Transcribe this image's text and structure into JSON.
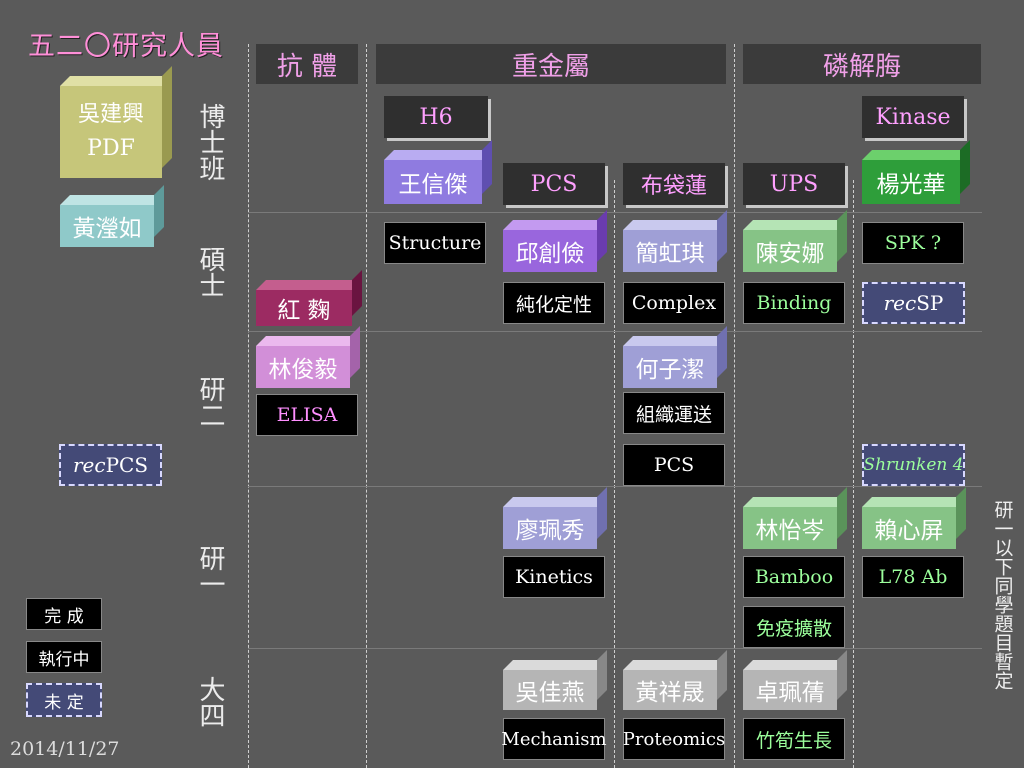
{
  "title": "五二〇研究人員",
  "headers": {
    "antibody": "抗 體",
    "heavy_metal": "重金屬",
    "phosphatase": "磷解脢"
  },
  "rows": {
    "phd": "博士班",
    "master": "碩士",
    "y2": "研二",
    "y1": "研一",
    "senior": "大四"
  },
  "left": {
    "advisor_line1": "吳建興",
    "advisor_line2": "PDF",
    "assistant": "黃瀅如",
    "rec_pcs_prefix": "rec",
    "rec_pcs_suffix": "PCS"
  },
  "phd": {
    "h6": "H6",
    "wang": "王信傑",
    "pcs": "PCS",
    "bu": "布袋蓮",
    "ups": "UPS",
    "kinase": "Kinase",
    "yang": "楊光華"
  },
  "master": {
    "structure": "Structure",
    "qiu": "邱創儉",
    "chun": "純化定性",
    "jian": "簡虹琪",
    "complex": "Complex",
    "chen": "陳安娜",
    "binding": "Binding",
    "spk": "SPK ?",
    "rec_prefix": "rec",
    "rec_suffix": "SP",
    "hong": "紅 麴"
  },
  "y2": {
    "lin": "林俊毅",
    "elisa": "ELISA",
    "he": "何子潔",
    "zu": "組織運送",
    "pcs": "PCS",
    "shrunken": "Shrunken 4"
  },
  "y1": {
    "liao": "廖珮秀",
    "kinetics": "Kinetics",
    "linyi": "林怡岑",
    "bamboo": "Bamboo",
    "mianyi": "免疫擴散",
    "lai": "賴心屏",
    "l78": "L78 Ab"
  },
  "senior": {
    "wu": "吳佳燕",
    "mechanism": "Mechanism",
    "huang": "黃祥晟",
    "proteomics": "Proteomics",
    "zhuo": "卓珮蒨",
    "zhusun": "竹筍生長"
  },
  "legend": {
    "done": "完 成",
    "doing": "執行中",
    "undecided": "未 定"
  },
  "date": "2014/11/27",
  "side_note": "研一以下同學題目暫定"
}
